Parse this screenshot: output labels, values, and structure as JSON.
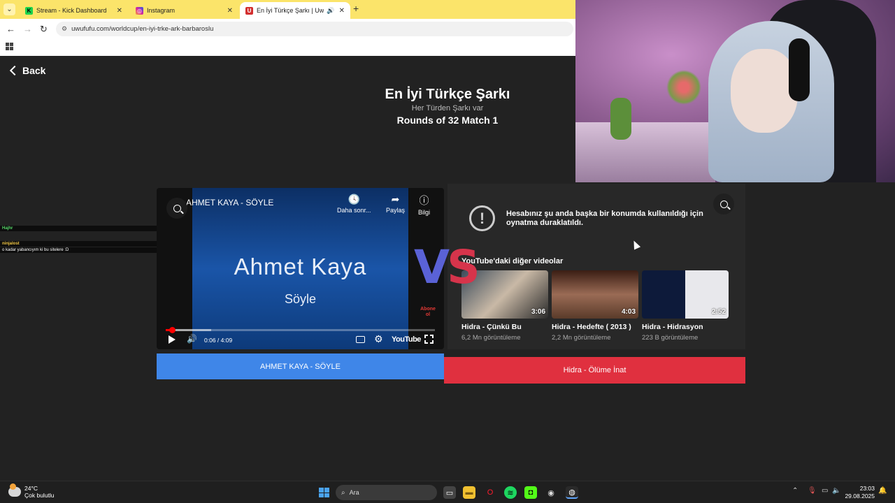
{
  "browser": {
    "tabs": [
      {
        "label": "Stream - Kick Dashboard",
        "icon": "kick-icon"
      },
      {
        "label": "Instagram",
        "icon": "instagram-icon"
      },
      {
        "label": "En İyi Türkçe Şarkı | UwUFUFU",
        "icon": "uwufufu-icon",
        "active": true
      }
    ],
    "url": "uwufufu.com/worldcup/en-iyi-trke-ark-barbaroslu"
  },
  "page": {
    "back_label": "Back",
    "title": "En İyi Türkçe Şarkı",
    "subtitle": "Her Türden Şarkı var",
    "round": "Rounds of 32 Match 1",
    "vs_v": "V",
    "vs_s": "S"
  },
  "left_video": {
    "title": "AHMET KAYA - SÖYLE",
    "artist_overlay": "Ahmet  Kaya",
    "song_overlay": "Söyle",
    "watch_later": "Daha sonr...",
    "share": "Paylaş",
    "info": "Bilgi",
    "time": "0:06 / 4:09",
    "progress_fraction": 0.024,
    "buffered_fraction": 0.17,
    "youtube_label": "YouTube",
    "abone": "Abone ol",
    "vote_label": "AHMET KAYA - SÖYLE"
  },
  "right_video": {
    "message": "Hesabınız şu anda başka bir konumda kullanıldığı için oynatma duraklatıldı.",
    "more_videos": "YouTube'daki diğer videolar",
    "thumbnails": [
      {
        "title": "Hidra - Çünkü Bu",
        "views": "6,2 Mn görüntüleme",
        "duration": "3:06"
      },
      {
        "title": "Hidra - Hedefte ( 2013 )",
        "views": "2,2 Mn görüntüleme",
        "duration": "4:03"
      },
      {
        "title": "Hidra - Hidrasyon",
        "views": "223 B görüntüleme",
        "duration": "2:52"
      }
    ],
    "vote_label": "Hidra - Ölüme İnat"
  },
  "chat": [
    {
      "user": "Hajhr",
      "text": ""
    },
    {
      "user": "ninjalost",
      "text": ""
    },
    {
      "user": "",
      "text": "o kadar yabancıyım ki bu sitelere :D"
    }
  ],
  "taskbar": {
    "temperature": "24°C",
    "weather": "Çok bulutlu",
    "search_placeholder": "Ara",
    "time": "23:03",
    "date": "29.08.2025"
  },
  "colors": {
    "vote_left": "#3f86e8",
    "vote_right": "#e0303f",
    "vs_v": "#5a62d6",
    "vs_s": "#d6344b",
    "tabbar": "#fbe46a"
  }
}
